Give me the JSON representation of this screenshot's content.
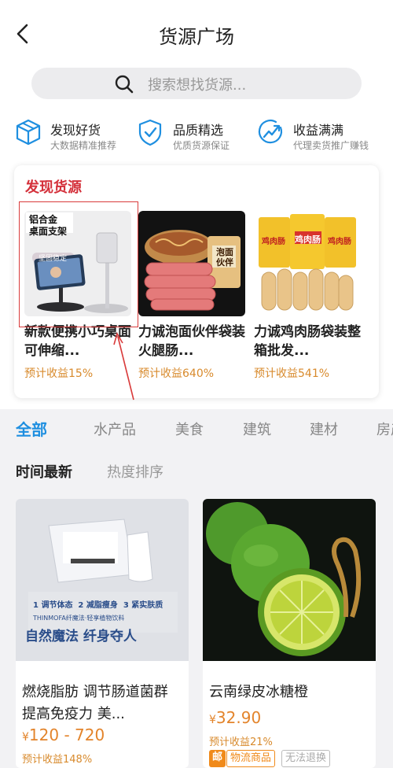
{
  "header": {
    "title": "货源广场"
  },
  "search": {
    "placeholder": "搜索想找货源..."
  },
  "features": [
    {
      "title": "发现好货",
      "subtitle": "大数据精准推荐",
      "icon": "cube-icon"
    },
    {
      "title": "品质精选",
      "subtitle": "优质货源保证",
      "icon": "shield-check-icon"
    },
    {
      "title": "收益满满",
      "subtitle": "代理卖货推广赚钱",
      "icon": "trend-up-icon"
    }
  ],
  "discover": {
    "title": "发现货源",
    "items": [
      {
        "name": "新款便携小巧桌面可伸缩...",
        "earn": "预计收益15%",
        "image_text": [
          "铝合金",
          "桌面支架",
          "坚固稳定"
        ]
      },
      {
        "name": "力诚泡面伙伴袋装火腿肠...",
        "earn": "预计收益640%",
        "image_text": [
          "泡面伙伴"
        ]
      },
      {
        "name": "力诚鸡肉肠袋装整箱批发...",
        "earn": "预计收益541%",
        "image_text": [
          "鸡肉肠",
          "鸡肉肠",
          "鸡肉肠"
        ]
      }
    ]
  },
  "categories": [
    "全部",
    "水产品",
    "美食",
    "建筑",
    "建材",
    "房产"
  ],
  "sort": [
    "时间最新",
    "热度排序"
  ],
  "products": [
    {
      "name": "燃烧脂肪 调节肠道菌群 提高免疫力 美...",
      "currency": "¥",
      "price": "120 - 720",
      "earn": "预计收益148%",
      "image_text": {
        "steps": [
          "1 调节体态",
          "2 减脂瘦身",
          "3 紧实肤质"
        ],
        "brand": "THINMOFA纤魔法·轻享植物饮料",
        "slogan": "自然魔法 纤身夺人"
      }
    },
    {
      "name": "云南绿皮冰糖橙",
      "currency": "¥",
      "price": "32.90",
      "earn": "预计收益21%",
      "tags": {
        "mail": "邮",
        "logistics": "物流商品",
        "no_return": "无法退换"
      }
    }
  ],
  "colors": {
    "accent": "#1f8fe0",
    "red": "#d4303a",
    "earn": "#d88a2c",
    "price": "#e3842b"
  }
}
